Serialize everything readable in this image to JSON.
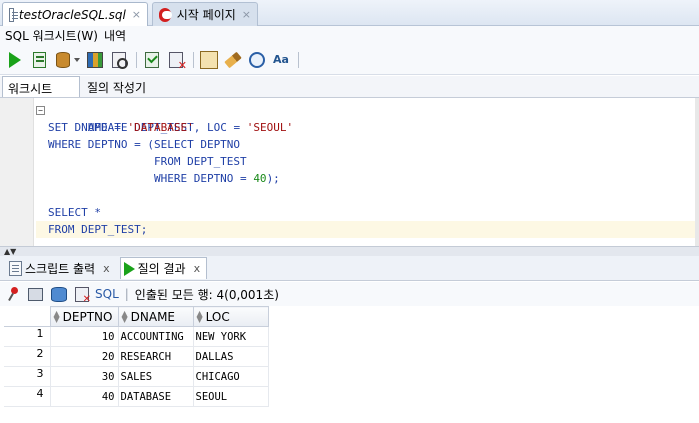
{
  "doc_tabs": [
    {
      "label": "testOracleSQL.sql",
      "close": "×"
    },
    {
      "label": "시작 페이지",
      "close": "×"
    }
  ],
  "menu": {
    "items": [
      "SQL 워크시트(W)",
      "내역"
    ]
  },
  "toolbar": {
    "icons": [
      "run-statement-icon",
      "run-script-icon",
      "commit-icon",
      "rollback-icon",
      "explain-plan-icon",
      "autotrace-icon",
      "sql-tuning-icon",
      "clear-icon",
      "history-icon",
      "format-icon"
    ]
  },
  "sub_tabs": [
    "워크시트",
    "질의 작성기"
  ],
  "editor": {
    "lines": [
      {
        "text": "UPDATE DEPT_TEST",
        "fold": "−"
      },
      {
        "text": "SET DNAME = 'DATABASE', LOC = 'SEOUL'"
      },
      {
        "text": "WHERE DEPTNO = (SELECT DEPTNO"
      },
      {
        "text": "                FROM DEPT_TEST"
      },
      {
        "text": "                WHERE DEPTNO = 40);"
      },
      {
        "text": ""
      },
      {
        "text": "SELECT *"
      },
      {
        "text": "FROM DEPT_TEST;",
        "current": true
      }
    ]
  },
  "output_tabs": [
    {
      "label": "스크립트 출력",
      "close": "x"
    },
    {
      "label": "질의 결과",
      "close": "x"
    }
  ],
  "results_toolbar": {
    "sql_label": "SQL",
    "separator": "|",
    "status": "인출된 모든 행: 4(0,001초)"
  },
  "grid": {
    "columns": [
      "DEPTNO",
      "DNAME",
      "LOC"
    ],
    "rows": [
      {
        "num": "1",
        "deptno": "10",
        "dname": "ACCOUNTING",
        "loc": "NEW YORK"
      },
      {
        "num": "2",
        "deptno": "20",
        "dname": "RESEARCH",
        "loc": "DALLAS"
      },
      {
        "num": "3",
        "deptno": "30",
        "dname": "SALES",
        "loc": "CHICAGO"
      },
      {
        "num": "4",
        "deptno": "40",
        "dname": "DATABASE",
        "loc": "SEOUL"
      }
    ]
  },
  "colors": {
    "keyword": "#1f3fa6",
    "string": "#a01010",
    "number": "#1a8a1a",
    "current_line": "#fdf8e4",
    "run_green": "#1aa21a"
  }
}
